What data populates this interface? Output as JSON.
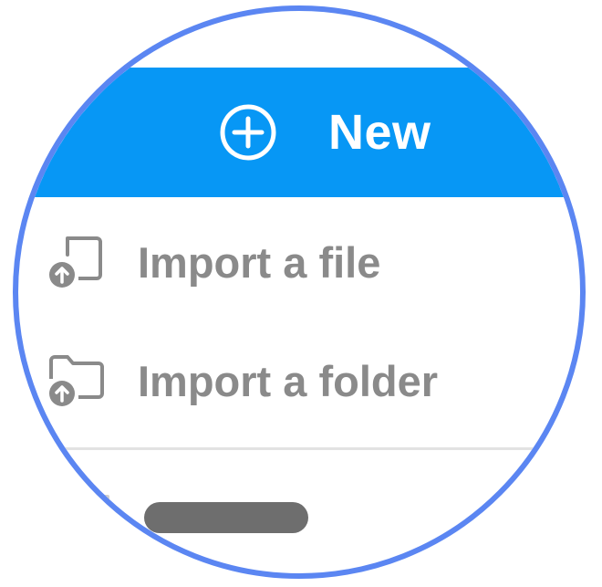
{
  "new_menu": {
    "new_label": "New",
    "new_icon": "plus-circle-icon",
    "bar_color": "#0797f5"
  },
  "items": [
    {
      "label": "Import a file",
      "icon": "file-upload-icon"
    },
    {
      "label": "Import a folder",
      "icon": "folder-upload-icon"
    }
  ],
  "colors": {
    "ring": "#5b86f2",
    "item_text": "#8a8a8a",
    "divider": "#e2e2e2"
  }
}
